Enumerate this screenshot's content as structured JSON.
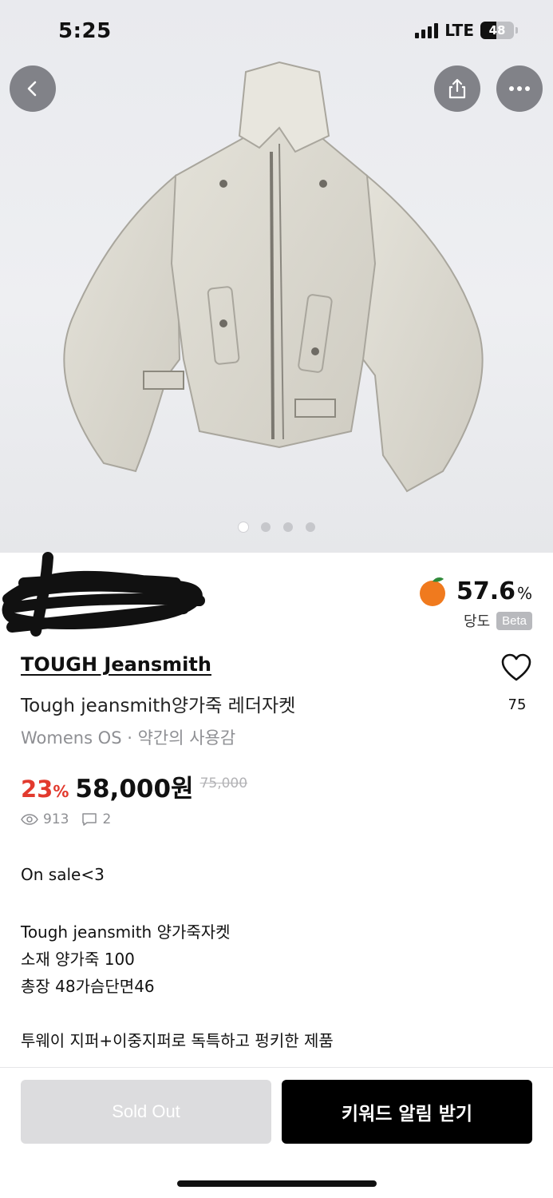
{
  "status_bar": {
    "time": "5:25",
    "network": "LTE",
    "battery": "48"
  },
  "icons": {
    "back": "chevron-left-icon",
    "share": "share-icon",
    "more": "more-icon",
    "heart": "heart-icon",
    "views": "eye-icon",
    "comments": "comment-icon",
    "freshness": "orange-icon"
  },
  "gallery": {
    "slide_count": 4,
    "active_index": 0
  },
  "seller": {
    "freshness_value": "57.6",
    "freshness_unit": "%",
    "freshness_label": "당도",
    "beta_label": "Beta"
  },
  "product": {
    "brand": "TOUGH Jeansmith",
    "title": "Tough jeansmith양가죽 레더자켓",
    "meta": "Womens OS · 약간의 사용감",
    "likes": "75",
    "discount_value": "23",
    "discount_unit": "%",
    "price": "58,000원",
    "original_price": "75,000",
    "views": "913",
    "comments": "2",
    "description": [
      "On sale<3",
      "Tough jeansmith 양가죽자켓",
      "소재 양가죽 100",
      "총장 48가슴단면46",
      "투웨이 지퍼+이중지퍼로 독특하고 펑키한 제품"
    ]
  },
  "actions": {
    "sold_out": "Sold Out",
    "keyword_alert": "키워드 알림 받기"
  },
  "colors": {
    "discount": "#e23a2e",
    "primary_button": "#000000",
    "disabled_button": "#dcdcde",
    "freshness_icon": "#f07a1e"
  }
}
